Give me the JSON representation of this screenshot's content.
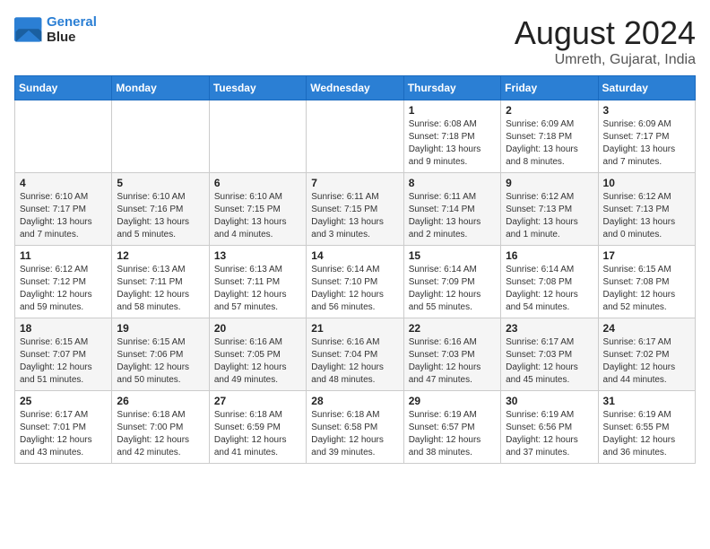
{
  "logo": {
    "line1": "General",
    "line2": "Blue"
  },
  "title": "August 2024",
  "subtitle": "Umreth, Gujarat, India",
  "weekdays": [
    "Sunday",
    "Monday",
    "Tuesday",
    "Wednesday",
    "Thursday",
    "Friday",
    "Saturday"
  ],
  "weeks": [
    [
      {
        "day": "",
        "info": ""
      },
      {
        "day": "",
        "info": ""
      },
      {
        "day": "",
        "info": ""
      },
      {
        "day": "",
        "info": ""
      },
      {
        "day": "1",
        "info": "Sunrise: 6:08 AM\nSunset: 7:18 PM\nDaylight: 13 hours\nand 9 minutes."
      },
      {
        "day": "2",
        "info": "Sunrise: 6:09 AM\nSunset: 7:18 PM\nDaylight: 13 hours\nand 8 minutes."
      },
      {
        "day": "3",
        "info": "Sunrise: 6:09 AM\nSunset: 7:17 PM\nDaylight: 13 hours\nand 7 minutes."
      }
    ],
    [
      {
        "day": "4",
        "info": "Sunrise: 6:10 AM\nSunset: 7:17 PM\nDaylight: 13 hours\nand 7 minutes."
      },
      {
        "day": "5",
        "info": "Sunrise: 6:10 AM\nSunset: 7:16 PM\nDaylight: 13 hours\nand 5 minutes."
      },
      {
        "day": "6",
        "info": "Sunrise: 6:10 AM\nSunset: 7:15 PM\nDaylight: 13 hours\nand 4 minutes."
      },
      {
        "day": "7",
        "info": "Sunrise: 6:11 AM\nSunset: 7:15 PM\nDaylight: 13 hours\nand 3 minutes."
      },
      {
        "day": "8",
        "info": "Sunrise: 6:11 AM\nSunset: 7:14 PM\nDaylight: 13 hours\nand 2 minutes."
      },
      {
        "day": "9",
        "info": "Sunrise: 6:12 AM\nSunset: 7:13 PM\nDaylight: 13 hours\nand 1 minute."
      },
      {
        "day": "10",
        "info": "Sunrise: 6:12 AM\nSunset: 7:13 PM\nDaylight: 13 hours\nand 0 minutes."
      }
    ],
    [
      {
        "day": "11",
        "info": "Sunrise: 6:12 AM\nSunset: 7:12 PM\nDaylight: 12 hours\nand 59 minutes."
      },
      {
        "day": "12",
        "info": "Sunrise: 6:13 AM\nSunset: 7:11 PM\nDaylight: 12 hours\nand 58 minutes."
      },
      {
        "day": "13",
        "info": "Sunrise: 6:13 AM\nSunset: 7:11 PM\nDaylight: 12 hours\nand 57 minutes."
      },
      {
        "day": "14",
        "info": "Sunrise: 6:14 AM\nSunset: 7:10 PM\nDaylight: 12 hours\nand 56 minutes."
      },
      {
        "day": "15",
        "info": "Sunrise: 6:14 AM\nSunset: 7:09 PM\nDaylight: 12 hours\nand 55 minutes."
      },
      {
        "day": "16",
        "info": "Sunrise: 6:14 AM\nSunset: 7:08 PM\nDaylight: 12 hours\nand 54 minutes."
      },
      {
        "day": "17",
        "info": "Sunrise: 6:15 AM\nSunset: 7:08 PM\nDaylight: 12 hours\nand 52 minutes."
      }
    ],
    [
      {
        "day": "18",
        "info": "Sunrise: 6:15 AM\nSunset: 7:07 PM\nDaylight: 12 hours\nand 51 minutes."
      },
      {
        "day": "19",
        "info": "Sunrise: 6:15 AM\nSunset: 7:06 PM\nDaylight: 12 hours\nand 50 minutes."
      },
      {
        "day": "20",
        "info": "Sunrise: 6:16 AM\nSunset: 7:05 PM\nDaylight: 12 hours\nand 49 minutes."
      },
      {
        "day": "21",
        "info": "Sunrise: 6:16 AM\nSunset: 7:04 PM\nDaylight: 12 hours\nand 48 minutes."
      },
      {
        "day": "22",
        "info": "Sunrise: 6:16 AM\nSunset: 7:03 PM\nDaylight: 12 hours\nand 47 minutes."
      },
      {
        "day": "23",
        "info": "Sunrise: 6:17 AM\nSunset: 7:03 PM\nDaylight: 12 hours\nand 45 minutes."
      },
      {
        "day": "24",
        "info": "Sunrise: 6:17 AM\nSunset: 7:02 PM\nDaylight: 12 hours\nand 44 minutes."
      }
    ],
    [
      {
        "day": "25",
        "info": "Sunrise: 6:17 AM\nSunset: 7:01 PM\nDaylight: 12 hours\nand 43 minutes."
      },
      {
        "day": "26",
        "info": "Sunrise: 6:18 AM\nSunset: 7:00 PM\nDaylight: 12 hours\nand 42 minutes."
      },
      {
        "day": "27",
        "info": "Sunrise: 6:18 AM\nSunset: 6:59 PM\nDaylight: 12 hours\nand 41 minutes."
      },
      {
        "day": "28",
        "info": "Sunrise: 6:18 AM\nSunset: 6:58 PM\nDaylight: 12 hours\nand 39 minutes."
      },
      {
        "day": "29",
        "info": "Sunrise: 6:19 AM\nSunset: 6:57 PM\nDaylight: 12 hours\nand 38 minutes."
      },
      {
        "day": "30",
        "info": "Sunrise: 6:19 AM\nSunset: 6:56 PM\nDaylight: 12 hours\nand 37 minutes."
      },
      {
        "day": "31",
        "info": "Sunrise: 6:19 AM\nSunset: 6:55 PM\nDaylight: 12 hours\nand 36 minutes."
      }
    ]
  ]
}
